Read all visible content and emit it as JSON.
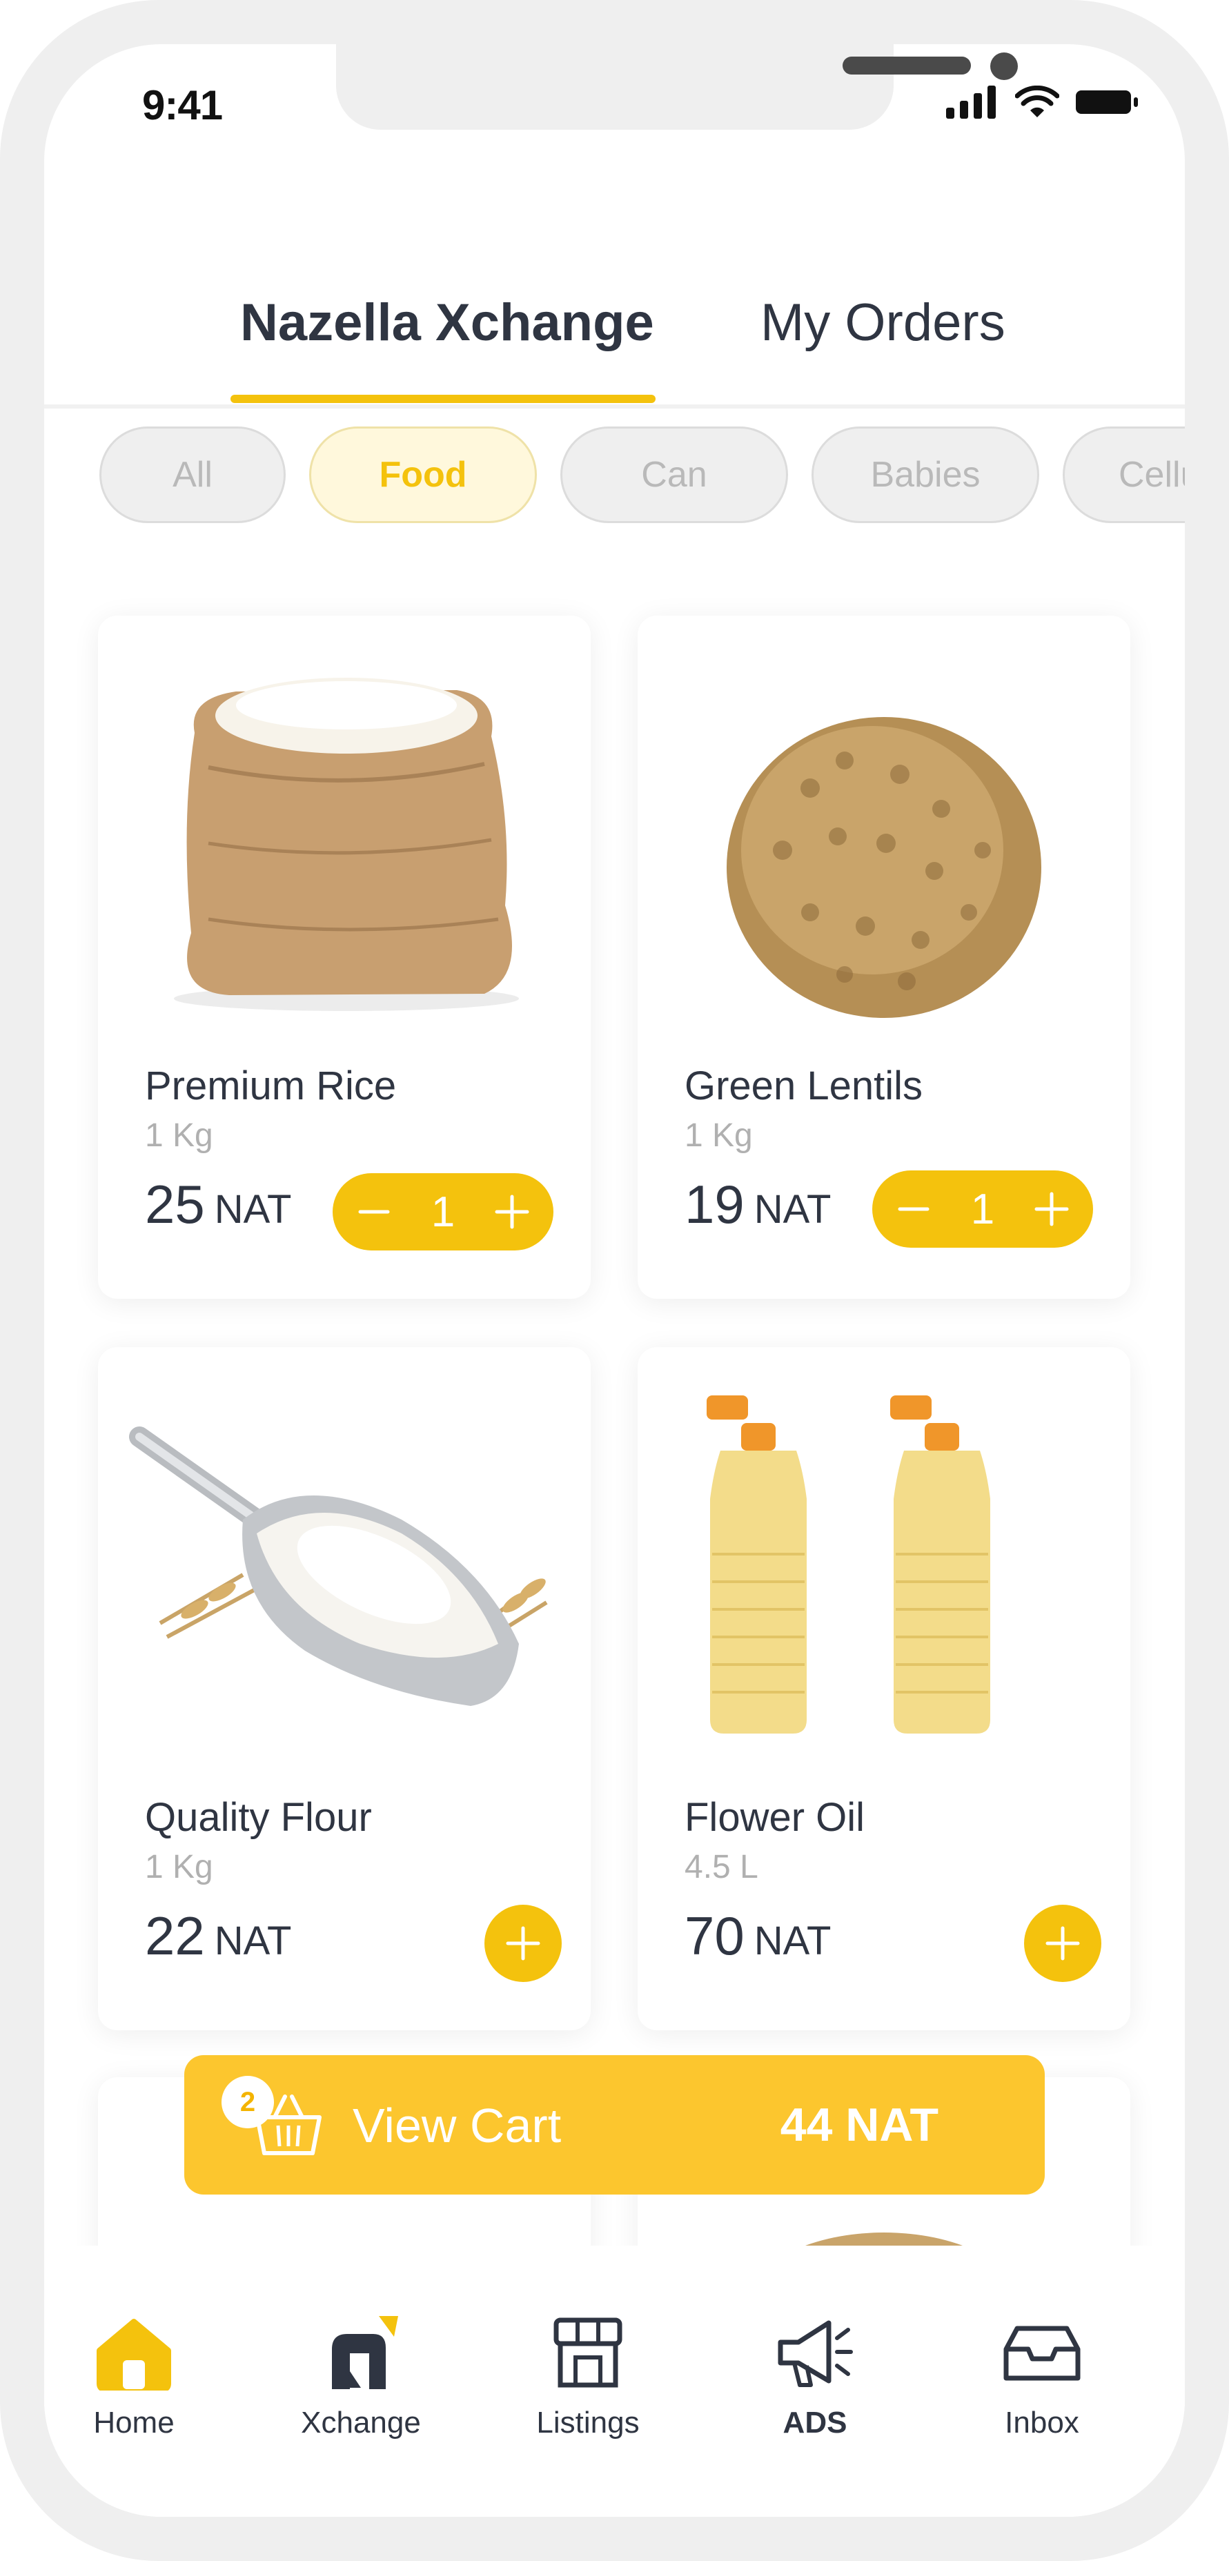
{
  "status_bar": {
    "time": "9:41"
  },
  "header": {
    "tabs": [
      {
        "label": "Nazella Xchange",
        "active": true
      },
      {
        "label": "My Orders",
        "active": false
      }
    ]
  },
  "categories": [
    {
      "label": "All",
      "selected": false
    },
    {
      "label": "Food",
      "selected": true
    },
    {
      "label": "Can",
      "selected": false
    },
    {
      "label": "Babies",
      "selected": false
    },
    {
      "label": "Cellu",
      "selected": false
    }
  ],
  "products": [
    {
      "name": "Premium Rice",
      "unit": "1 Kg",
      "price": "25",
      "currency": "NAT",
      "quantity": "1",
      "image": "rice-sack"
    },
    {
      "name": "Green Lentils",
      "unit": "1 Kg",
      "price": "19",
      "currency": "NAT",
      "quantity": "1",
      "image": "lentils-pile"
    },
    {
      "name": "Quality Flour",
      "unit": "1 Kg",
      "price": "22",
      "currency": "NAT",
      "quantity": null,
      "image": "flour-scoop"
    },
    {
      "name": "Flower Oil",
      "unit": "4.5 L",
      "price": "70",
      "currency": "NAT",
      "quantity": null,
      "image": "oil-bottles"
    }
  ],
  "cart": {
    "count": "2",
    "label": "View Cart",
    "total": "44 NAT"
  },
  "bottom_nav": [
    {
      "label": "Home",
      "icon": "home-icon",
      "active": true
    },
    {
      "label": "Xchange",
      "icon": "xchange-icon",
      "active": false
    },
    {
      "label": "Listings",
      "icon": "storefront-icon",
      "active": false
    },
    {
      "label": "ADS",
      "icon": "megaphone-icon",
      "active": false
    },
    {
      "label": "Inbox",
      "icon": "inbox-icon",
      "active": false
    }
  ],
  "colors": {
    "accent": "#f4c20d",
    "cart_bar": "#fcc62e",
    "text": "#2f3542",
    "muted": "#b0b0b0"
  }
}
